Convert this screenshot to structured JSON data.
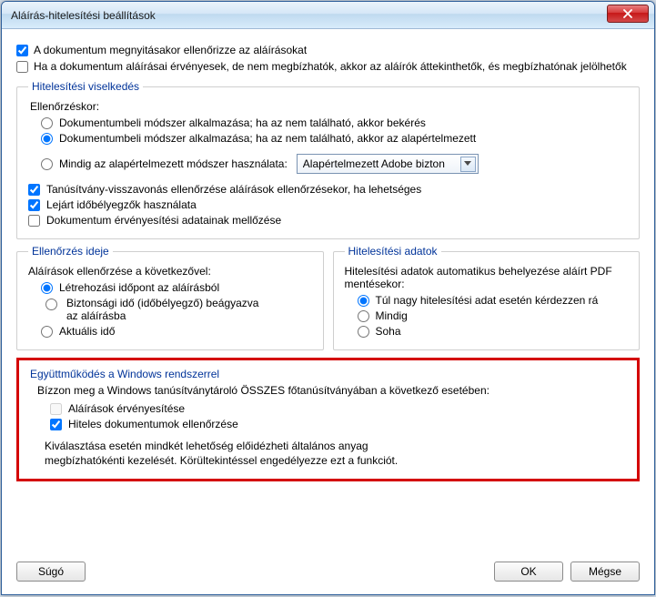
{
  "window": {
    "title": "Aláírás-hitelesítési beállítások"
  },
  "topChecks": {
    "verifyOnOpen": "A dokumentum megnyitásakor ellenőrizze az aláírásokat",
    "validButUntrusted": "Ha a dokumentum aláírásai érvényesek, de nem megbízhatók, akkor az aláírók áttekinthetők, és megbízhatónak jelölhetők"
  },
  "verification": {
    "legend": "Hitelesítési viselkedés",
    "whenVerifying": "Ellenőrzéskor:",
    "r1": "Dokumentumbeli módszer alkalmazása; ha az nem található, akkor bekérés",
    "r2": "Dokumentumbeli módszer alkalmazása; ha az nem található, akkor az alapértelmezett",
    "r3": "Mindig az alapértelmezett módszer használata:",
    "defaultMethod": "Alapértelmezett Adobe bizton",
    "revocation": "Tanúsítvány-visszavonás ellenőrzése aláírások ellenőrzésekor, ha lehetséges",
    "expiredTS": "Lejárt időbélyegzők használata",
    "ignoreDocValidation": "Dokumentum érvényesítési adatainak mellőzése"
  },
  "verifyTime": {
    "legend": "Ellenőrzés ideje",
    "sub": "Aláírások ellenőrzése a következővel:",
    "r1": "Létrehozási időpont az aláírásból",
    "r2": "Biztonsági idő (időbélyegző) beágyazva az aláírásba",
    "r3": "Aktuális idő"
  },
  "verifyInfo": {
    "legend": "Hitelesítési adatok",
    "sub": "Hitelesítési adatok automatikus behelyezése aláírt PDF mentésekor:",
    "r1": "Túl nagy hitelesítési adat esetén kérdezzen rá",
    "r2": "Mindig",
    "r3": "Soha"
  },
  "windowsIntegration": {
    "legend": "Együttműködés a Windows rendszerrel",
    "intro": "Bízzon meg a Windows tanúsítványtároló ÖSSZES főtanúsítványában a következő esetében:",
    "c1": "Aláírások érvényesítése",
    "c2": "Hiteles dokumentumok ellenőrzése",
    "warn1": "Kiválasztása esetén mindkét lehetőség előidézheti általános anyag",
    "warn2": "megbízhatókénti kezelését. Körültekintéssel engedélyezze ezt a funkciót."
  },
  "buttons": {
    "help": "Súgó",
    "ok": "OK",
    "cancel": "Mégse"
  }
}
